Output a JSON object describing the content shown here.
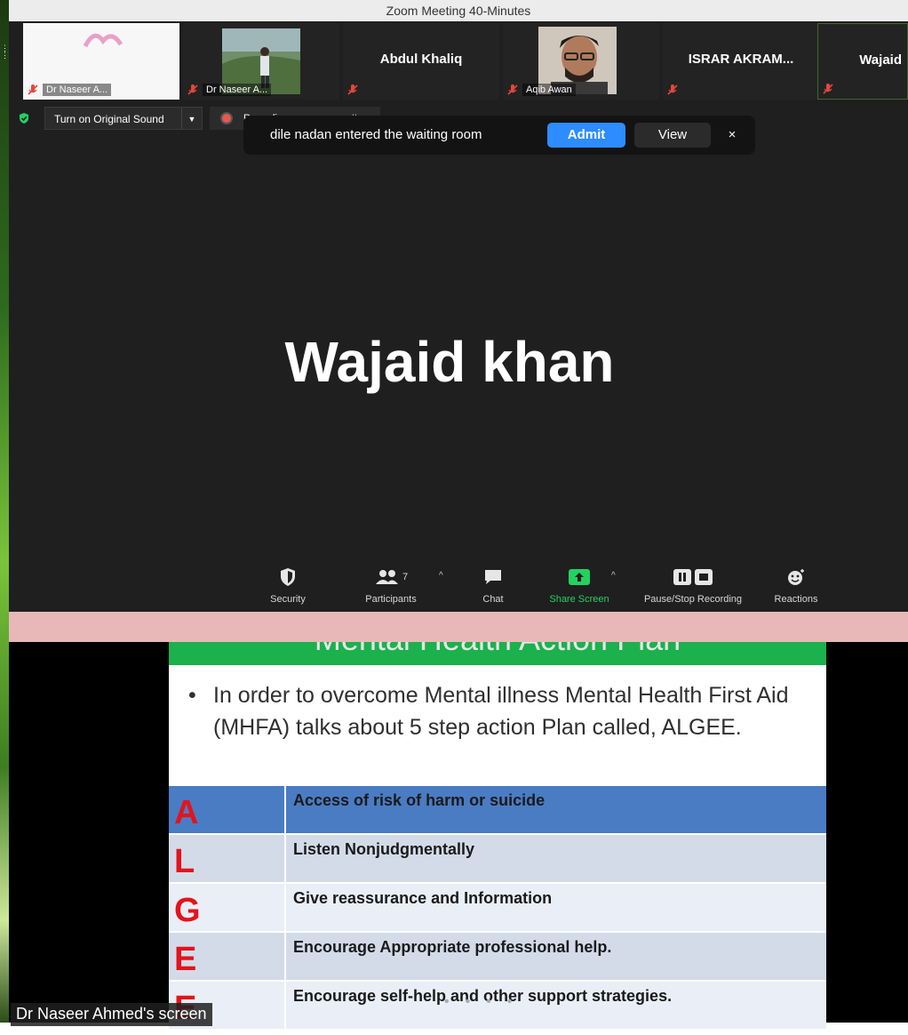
{
  "window": {
    "title": "Zoom Meeting 40-Minutes"
  },
  "gallery": [
    {
      "name": "Dr Naseer A...",
      "type": "video-sketch"
    },
    {
      "name": "Dr Naseer A...",
      "type": "video-outdoor"
    },
    {
      "name": "",
      "bigname": "Abdul Khaliq",
      "type": "name"
    },
    {
      "name": "Aqib Awan",
      "type": "video-portrait"
    },
    {
      "name": "",
      "bigname": "ISRAR AKRAM...",
      "type": "name"
    },
    {
      "name": "",
      "bigname": "Wajaid",
      "type": "name"
    }
  ],
  "audio": {
    "original_sound_label": "Turn on Original Sound",
    "recording_label": "Recording..."
  },
  "notification": {
    "message": "dile nadan entered the waiting room",
    "admit_label": "Admit",
    "view_label": "View",
    "close_label": "×"
  },
  "active_speaker": {
    "name": "Wajaid khan"
  },
  "toolbar": {
    "security": "Security",
    "participants": "Participants",
    "participants_count": "7",
    "chat": "Chat",
    "share_screen": "Share Screen",
    "recording": "Pause/Stop Recording",
    "reactions": "Reactions"
  },
  "slide": {
    "title": "Mental Health Action Plan",
    "bullet": "In order to overcome Mental illness Mental Health First Aid (MHFA) talks about 5 step action Plan called, ALGEE.",
    "rows": [
      {
        "letter": "A",
        "text": "Access of risk of harm or suicide"
      },
      {
        "letter": "L",
        "text": "Listen Nonjudgmentally"
      },
      {
        "letter": "G",
        "text": "Give reassurance and Information"
      },
      {
        "letter": "E",
        "text": "Encourage Appropriate professional help."
      },
      {
        "letter": "E",
        "text": "Encourage self-help and other support strategies."
      }
    ]
  },
  "share": {
    "label": "Dr Naseer Ahmed's screen"
  },
  "colors": {
    "admit": "#2d8cff",
    "share_green": "#1bb14c",
    "letter_red": "#e3141b",
    "highlight_row": "#4a7cc4"
  }
}
